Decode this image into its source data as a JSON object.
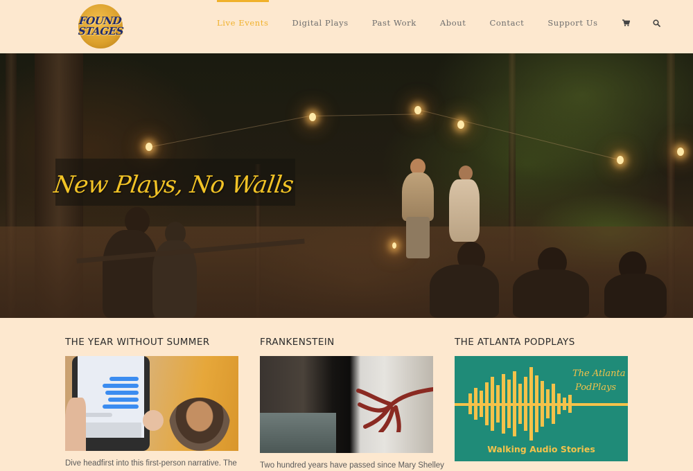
{
  "logo": {
    "line1": "FOUND",
    "line2": "STAGES"
  },
  "nav": {
    "items": [
      {
        "label": "Live Events",
        "active": true
      },
      {
        "label": "Digital Plays",
        "active": false
      },
      {
        "label": "Past Work",
        "active": false
      },
      {
        "label": "About",
        "active": false
      },
      {
        "label": "Contact",
        "active": false
      },
      {
        "label": "Support Us",
        "active": false
      }
    ],
    "cart_icon": "cart-icon",
    "search_icon": "search-icon"
  },
  "hero": {
    "title": "New Plays, No Walls"
  },
  "cards": [
    {
      "title": "THE YEAR WITHOUT SUMMER",
      "text": "Dive headfirst into this first-person narrative. The"
    },
    {
      "title": "FRANKENSTEIN",
      "text": "Two hundred years have passed since Mary Shelley"
    },
    {
      "title": "THE ATLANTA PODPLAYS",
      "image_title_line1": "The Atlanta",
      "image_title_line2": "PodPlays",
      "image_caption": "Walking Audio Stories"
    }
  ],
  "colors": {
    "background": "#fde8cf",
    "accent": "#f0b12b",
    "nav_text": "#6c6c6c",
    "podplays_teal": "#1f8b78",
    "podplays_yellow": "#f4c24a"
  }
}
